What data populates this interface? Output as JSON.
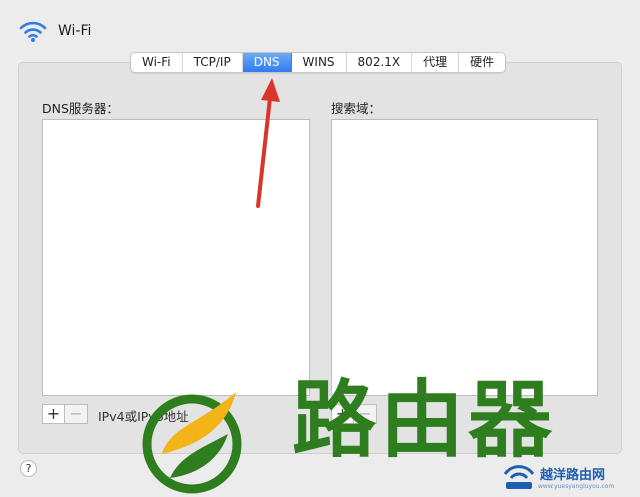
{
  "window": {
    "title": "Wi-Fi"
  },
  "tabs": [
    {
      "label": "Wi-Fi",
      "active": false
    },
    {
      "label": "TCP/IP",
      "active": false
    },
    {
      "label": "DNS",
      "active": true
    },
    {
      "label": "WINS",
      "active": false
    },
    {
      "label": "802.1X",
      "active": false
    },
    {
      "label": "代理",
      "active": false
    },
    {
      "label": "硬件",
      "active": false
    }
  ],
  "dns_servers": {
    "label": "DNS服务器：",
    "items": []
  },
  "search_domains": {
    "label": "搜索域：",
    "items": []
  },
  "controls": {
    "add_symbol": "+",
    "remove_symbol": "−",
    "address_hint": "IPv4或IPv6地址",
    "help_symbol": "?"
  },
  "watermark": {
    "main_text": "路由器",
    "site_text": "越洋路由网",
    "url_text": "www.yuesyangluyou.com"
  },
  "colors": {
    "accent": "#2f7bf0",
    "arrow": "#d9352a",
    "watermark_green": "#2e7d1e"
  }
}
